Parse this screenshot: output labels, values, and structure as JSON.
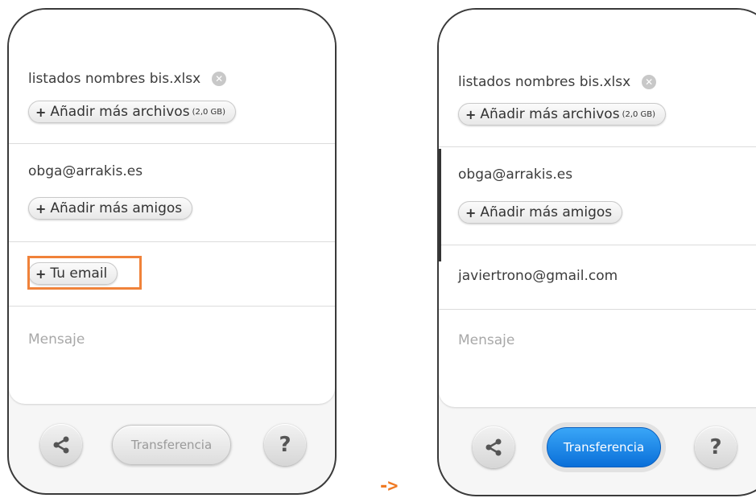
{
  "before": {
    "file": {
      "name": "listados nombres bis.xlsx",
      "add_more_label": "Añadir más archivos",
      "size_note": "(2,0 GB)"
    },
    "friends": {
      "email": "obga@arrakis.es",
      "add_more_label": "Añadir más amigos"
    },
    "your_email": {
      "label": "Tu email"
    },
    "message": {
      "placeholder": "Mensaje"
    },
    "footer": {
      "transfer_label": "Transferencia"
    }
  },
  "after": {
    "file": {
      "name": "listados nombres bis.xlsx",
      "add_more_label": "Añadir más archivos",
      "size_note": "(2,0 GB)"
    },
    "friends": {
      "email": "obga@arrakis.es",
      "add_more_label": "Añadir más amigos"
    },
    "your_email": {
      "value": "javiertrono@gmail.com"
    },
    "message": {
      "placeholder": "Mensaje"
    },
    "footer": {
      "transfer_label": "Transferencia"
    }
  },
  "arrow_text": "->",
  "colors": {
    "highlight": "#f0823a",
    "arrow": "#f07a24",
    "transfer_active": "#1a7fe6"
  },
  "icons": [
    "remove-icon",
    "plus-icon",
    "share-icon",
    "help-icon"
  ]
}
